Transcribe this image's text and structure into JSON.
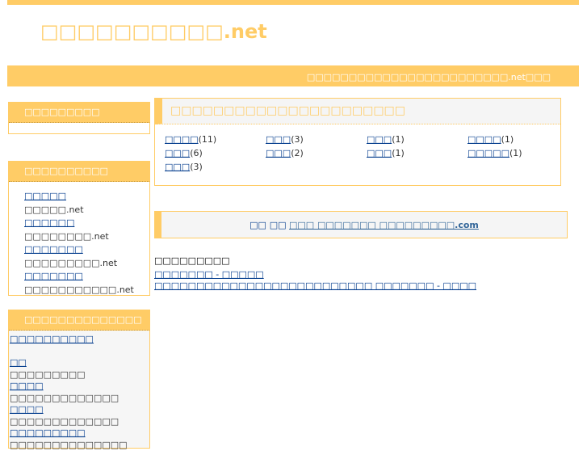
{
  "header": {
    "logo": "□□□□□□□□□□.net",
    "tagline": "□□□□□□□□□□□□□□□□□□□□□□□□.net□□□"
  },
  "sidebar": {
    "box1_title": "□□□□□□□□□",
    "box2_title": "□□□□□□□□□□",
    "box2_items": [
      {
        "link": "□□□□□",
        "text": "□□□□□.net"
      },
      {
        "link": "□□□□□□",
        "text": "□□□□□□□□.net"
      },
      {
        "link": "□□□□□□□",
        "text": "□□□□□□□□□.net"
      },
      {
        "link": "□□□□□□□",
        "text": "□□□□□□□□□□□.net"
      }
    ],
    "box3_title": "□□□□□□□□□□□□□□",
    "box3_items": [
      {
        "type": "link",
        "text": "□□□□□□□□□□"
      },
      {
        "type": "blank",
        "text": ""
      },
      {
        "type": "link",
        "text": "□□"
      },
      {
        "type": "text",
        "text": "□□□□□□□□□"
      },
      {
        "type": "link",
        "text": "□□□□"
      },
      {
        "type": "text",
        "text": "□□□□□□□□□□□□□"
      },
      {
        "type": "link",
        "text": "□□□□"
      },
      {
        "type": "text",
        "text": "□□□□□□□□□□□□□"
      },
      {
        "type": "link",
        "text": "□□□□□□□□□"
      },
      {
        "type": "text",
        "text": "□□□□□□□□□□□□□□"
      }
    ]
  },
  "categories": {
    "title": "□□□□□□□□□□□□□□□□□□□□□□",
    "items": [
      {
        "label": "□□□□",
        "count": "(11)"
      },
      {
        "label": "□□□",
        "count": "(3)"
      },
      {
        "label": "□□□",
        "count": "(1)"
      },
      {
        "label": "□□□□",
        "count": "(1)"
      },
      {
        "label": "□□□",
        "count": "(6)"
      },
      {
        "label": "□□□",
        "count": "(2)"
      },
      {
        "label": "□□□",
        "count": "(1)"
      },
      {
        "label": "□□□□□",
        "count": "(1)"
      },
      {
        "label": "□□□",
        "count": "(3)"
      }
    ]
  },
  "promo": {
    "prefix": "□□ □□",
    "link": "□□□ □□□□□□□ □□□□□□□□□.com"
  },
  "related": {
    "title": "□□□□□□□□□",
    "links": [
      "□□□□□□□ - □□□□□",
      "□□□□□□□□□□□□□□□□□□□□□□□□□□ □□□□□□□ - □□□□"
    ]
  }
}
